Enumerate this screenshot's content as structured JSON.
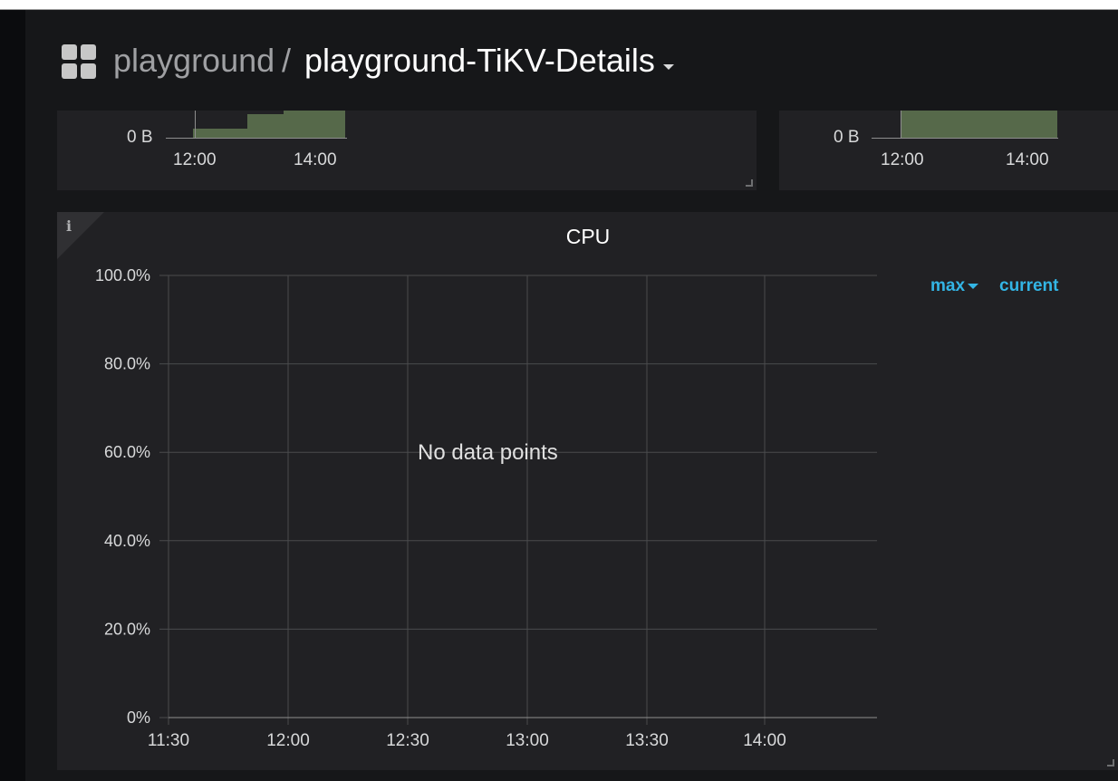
{
  "header": {
    "folder": "playground",
    "separator": "/",
    "dashboard_title": "playground-TiKV-Details"
  },
  "top_panels": [
    {
      "y_label": "0 B",
      "x_ticks": [
        "12:00",
        "14:00"
      ]
    },
    {
      "y_label": "0 B",
      "x_ticks": [
        "12:00",
        "14:00"
      ]
    }
  ],
  "cpu_panel": {
    "title": "CPU",
    "info_icon": "info-icon",
    "no_data_text": "No data points",
    "legend": {
      "max_label": "max",
      "current_label": "current"
    }
  },
  "colors": {
    "background": "#161719",
    "panel": "#212124",
    "grid": "#4a4b4d",
    "accent": "#33b5e5",
    "fill": "#56694a"
  },
  "chart_data": {
    "type": "line",
    "title": "CPU",
    "xlabel": "",
    "ylabel": "",
    "x_ticks": [
      "11:30",
      "12:00",
      "12:30",
      "13:00",
      "13:30",
      "14:00"
    ],
    "y_ticks": [
      "100.0%",
      "80.0%",
      "60.0%",
      "40.0%",
      "20.0%",
      "0%"
    ],
    "ylim": [
      0,
      100
    ],
    "grid": true,
    "legend": "right",
    "series": []
  }
}
